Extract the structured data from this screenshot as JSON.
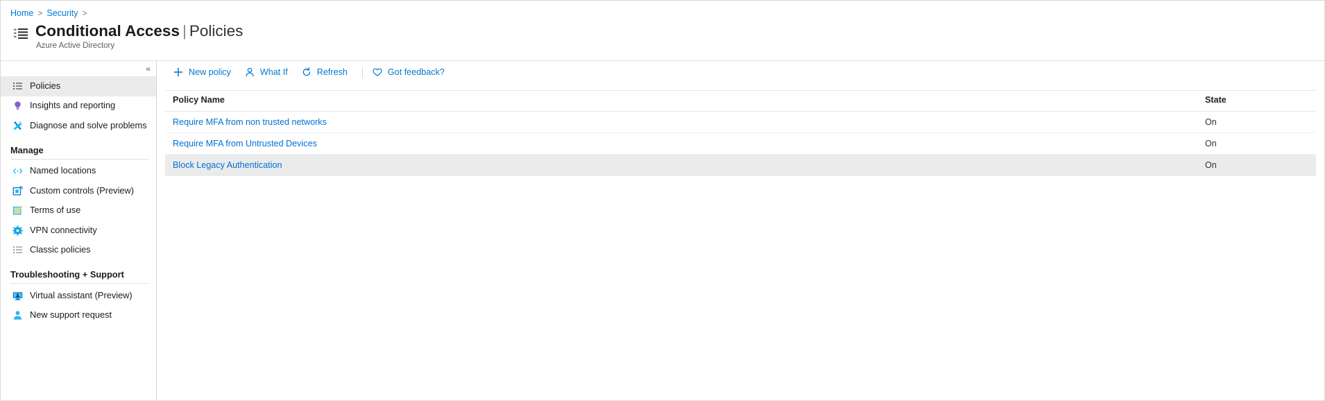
{
  "breadcrumb": {
    "items": [
      "Home",
      "Security"
    ],
    "separator": ">"
  },
  "header": {
    "icon": "list-bullet-icon",
    "title": "Conditional Access",
    "separator": "|",
    "subsection": "Policies",
    "subtitle": "Azure Active Directory"
  },
  "sidebar": {
    "collapse_label": "«",
    "items": [
      {
        "label": "Policies",
        "icon": "list-icon",
        "selected": true
      },
      {
        "label": "Insights and reporting",
        "icon": "lightbulb-icon",
        "selected": false
      },
      {
        "label": "Diagnose and solve problems",
        "icon": "wrench-icon",
        "selected": false
      }
    ],
    "groups": [
      {
        "title": "Manage",
        "items": [
          {
            "label": "Named locations",
            "icon": "code-brackets-icon"
          },
          {
            "label": "Custom controls (Preview)",
            "icon": "nested-square-icon"
          },
          {
            "label": "Terms of use",
            "icon": "checkbox-checked-icon"
          },
          {
            "label": "VPN connectivity",
            "icon": "gear-icon"
          },
          {
            "label": "Classic policies",
            "icon": "list-icon"
          }
        ]
      },
      {
        "title": "Troubleshooting + Support",
        "items": [
          {
            "label": "Virtual assistant (Preview)",
            "icon": "monitor-person-icon"
          },
          {
            "label": "New support request",
            "icon": "person-icon"
          }
        ]
      }
    ]
  },
  "commandbar": {
    "buttons": [
      {
        "label": "New policy",
        "icon": "plus-icon"
      },
      {
        "label": "What If",
        "icon": "person-icon"
      },
      {
        "label": "Refresh",
        "icon": "refresh-icon"
      },
      {
        "label": "Got feedback?",
        "icon": "heart-icon"
      }
    ]
  },
  "table": {
    "columns": [
      "Policy Name",
      "State"
    ],
    "rows": [
      {
        "name": "Require MFA from non trusted networks",
        "state": "On",
        "highlighted": false
      },
      {
        "name": "Require MFA from Untrusted Devices",
        "state": "On",
        "highlighted": false
      },
      {
        "name": "Block Legacy Authentication",
        "state": "On",
        "highlighted": true
      }
    ]
  },
  "colors": {
    "link": "#0078d4",
    "text": "#1b1b1b",
    "muted": "#605e5c",
    "selected_row": "#ebebeb",
    "purple": "#8661c5",
    "teal": "#00bcf2"
  }
}
